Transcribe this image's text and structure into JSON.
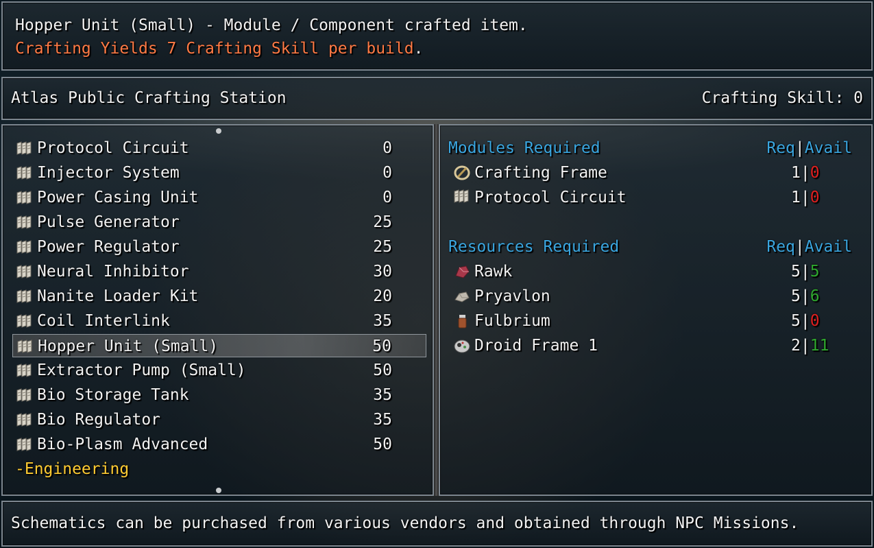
{
  "info": {
    "title": "Hopper Unit (Small) - Module / Component crafted item.",
    "yield_text": "Crafting Yields 7 Crafting Skill per build",
    "yield_suffix": "."
  },
  "header": {
    "station_name": "Atlas Public Crafting Station",
    "skill_label": "Crafting Skill: 0"
  },
  "schematics": {
    "items": [
      {
        "name": "Protocol Circuit",
        "value": "0"
      },
      {
        "name": "Injector System",
        "value": "0"
      },
      {
        "name": "Power Casing Unit",
        "value": "0"
      },
      {
        "name": "Pulse Generator",
        "value": "25"
      },
      {
        "name": "Power Regulator",
        "value": "25"
      },
      {
        "name": "Neural Inhibitor",
        "value": "30"
      },
      {
        "name": "Nanite Loader Kit",
        "value": "20"
      },
      {
        "name": "Coil Interlink",
        "value": "35"
      },
      {
        "name": "Hopper Unit (Small)",
        "value": "50"
      },
      {
        "name": "Extractor Pump (Small)",
        "value": "50"
      },
      {
        "name": "Bio Storage Tank",
        "value": "35"
      },
      {
        "name": "Bio Regulator",
        "value": "35"
      },
      {
        "name": "Bio-Plasm Advanced",
        "value": "50"
      }
    ],
    "selected_index": 8,
    "category": "-Engineering",
    "icon": "schematic-icon"
  },
  "modules": {
    "title": "Modules Required",
    "head_req": "Req",
    "head_sep": "|",
    "head_avail": "Avail",
    "items": [
      {
        "name": "Crafting Frame",
        "req": "1",
        "avail": "0",
        "icon": "crafting-frame-icon"
      },
      {
        "name": "Protocol Circuit",
        "req": "1",
        "avail": "0",
        "icon": "schematic-icon"
      }
    ]
  },
  "resources": {
    "title": "Resources Required",
    "head_req": "Req",
    "head_sep": "|",
    "head_avail": "Avail",
    "items": [
      {
        "name": "Rawk",
        "req": "5",
        "avail": "5",
        "icon": "rawk-icon"
      },
      {
        "name": "Pryavlon",
        "req": "5",
        "avail": "6",
        "icon": "pryavlon-icon"
      },
      {
        "name": "Fulbrium",
        "req": "5",
        "avail": "0",
        "icon": "fulbrium-icon"
      },
      {
        "name": "Droid Frame 1",
        "req": "2",
        "avail": "11",
        "icon": "droid-frame-icon"
      }
    ]
  },
  "footer": {
    "help_text": "Schematics can be purchased from various vendors and obtained through NPC Missions."
  },
  "colors": {
    "yield": "#ff7a45",
    "section_title": "#3aa6e0",
    "category": "#ffcc33",
    "insufficient": "#e02020",
    "sufficient": "#2fa82f"
  }
}
